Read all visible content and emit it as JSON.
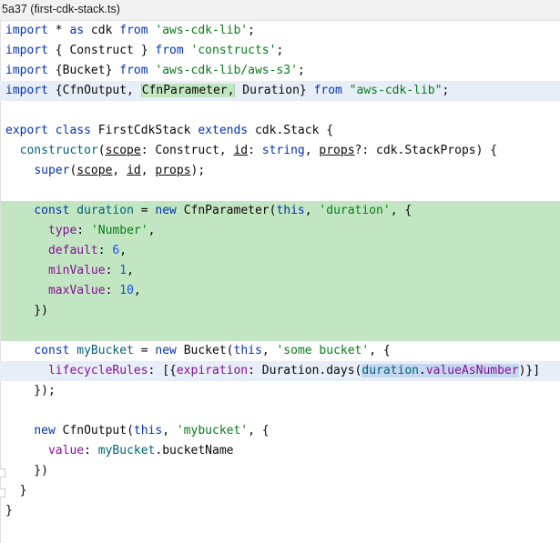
{
  "title": "5a37 (first-cdk-stack.ts)",
  "code": {
    "l1": {
      "a": "import",
      "b": " * ",
      "c": "as",
      "d": " cdk ",
      "e": "from",
      "f": " ",
      "g": "'aws-cdk-lib'",
      "h": ";"
    },
    "l2": {
      "a": "import",
      "b": " { Construct } ",
      "c": "from",
      "d": " ",
      "e": "'constructs'",
      "f": ";"
    },
    "l3": {
      "a": "import",
      "b": " {Bucket} ",
      "c": "from",
      "d": " ",
      "e": "'aws-cdk-lib/aws-s3'",
      "f": ";"
    },
    "l4": {
      "a": "import",
      "b": " {CfnOutput, ",
      "c": "CfnParameter,",
      "d": " Duration} ",
      "e": "from",
      "f": " ",
      "g": "\"aws-cdk-lib\"",
      "h": ";"
    },
    "l6": {
      "a": "export",
      "b": " ",
      "c": "class",
      "d": " FirstCdkStack ",
      "e": "extends",
      "f": " cdk.Stack {"
    },
    "l7": {
      "a": "  ",
      "b": "constructor",
      "c": "(",
      "d": "scope",
      "e": ": Construct, ",
      "f": "id",
      "g": ": ",
      "h": "string",
      "i": ", ",
      "j": "props",
      "k": "?: cdk.StackProps) {"
    },
    "l8": {
      "a": "    ",
      "b": "super",
      "c": "(",
      "d": "scope",
      "e": ", ",
      "f": "id",
      "g": ", ",
      "h": "props",
      "i": ");"
    },
    "l10": {
      "a": "    ",
      "b": "const",
      "c": " ",
      "d": "duration",
      "e": " = ",
      "f": "new",
      "g": " CfnParameter(",
      "h": "this",
      "i": ", ",
      "j": "'duration'",
      "k": ", {"
    },
    "l11": {
      "a": "      ",
      "b": "type",
      "c": ": ",
      "d": "'Number'",
      "e": ","
    },
    "l12": {
      "a": "      ",
      "b": "default",
      "c": ": ",
      "d": "6",
      "e": ","
    },
    "l13": {
      "a": "      ",
      "b": "minValue",
      "c": ": ",
      "d": "1",
      "e": ","
    },
    "l14": {
      "a": "      ",
      "b": "maxValue",
      "c": ": ",
      "d": "10",
      "e": ","
    },
    "l15": {
      "a": "    })"
    },
    "l17": {
      "a": "    ",
      "b": "const",
      "c": " ",
      "d": "myBucket",
      "e": " = ",
      "f": "new",
      "g": " Bucket(",
      "h": "this",
      "i": ", ",
      "j": "'some bucket'",
      "k": ", {"
    },
    "l18": {
      "a": "      ",
      "b": "lifecycleRules",
      "c": ": [{",
      "d": "expiration",
      "e": ": Duration.days(",
      "f": "duration",
      "g": ".",
      "h": "valueAsNumber",
      "i": ")}]"
    },
    "l19": {
      "a": "    });"
    },
    "l21": {
      "a": "    ",
      "b": "new",
      "c": " CfnOutput(",
      "d": "this",
      "e": ", ",
      "f": "'mybucket'",
      "g": ", {"
    },
    "l22": {
      "a": "      ",
      "b": "value",
      "c": ": ",
      "d": "myBucket",
      "e": ".bucketName"
    },
    "l23": {
      "a": "    })"
    },
    "l24": {
      "a": "  }"
    },
    "l25": {
      "a": "}"
    }
  },
  "colors": {
    "keyword": "#0033b3",
    "string": "#067d17",
    "property": "#871094",
    "number": "#1750eb",
    "reference": "#00627a",
    "added_block": "#c2e5c2",
    "current_line": "#e8eef8"
  }
}
